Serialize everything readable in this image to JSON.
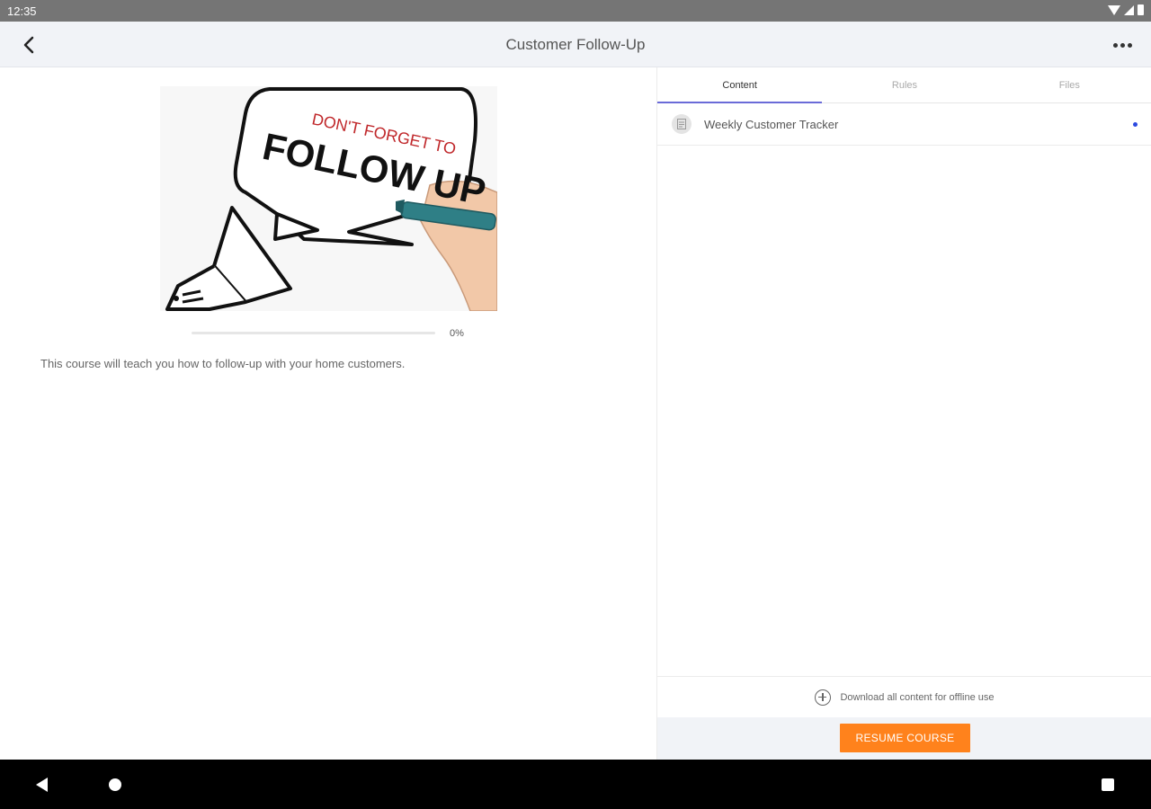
{
  "status_bar": {
    "time": "12:35",
    "icons": [
      "wifi-icon",
      "signal-icon",
      "battery-icon"
    ]
  },
  "app_bar": {
    "title": "Customer Follow-Up",
    "back_icon": "chevron-left-icon",
    "more_icon": "more-horizontal-icon"
  },
  "course": {
    "image_text_top": "DON'T FORGET TO",
    "image_text_main": "FOLLOW UP",
    "progress_label": "0%",
    "progress_fraction": 0,
    "description": "This course will teach you how to follow-up with your home customers."
  },
  "tabs": [
    {
      "label": "Content",
      "active": true
    },
    {
      "label": "Rules",
      "active": false
    },
    {
      "label": "Files",
      "active": false
    }
  ],
  "content_list": [
    {
      "label": "Weekly Customer Tracker",
      "icon": "document-icon",
      "unread": true
    }
  ],
  "download": {
    "label": "Download all content for offline use",
    "icon": "plus-circle-icon"
  },
  "resume_button": "RESUME COURSE",
  "colors": {
    "accent": "#ff821c",
    "tab_indicator": "#6a6bd8",
    "unread_dot": "#2b49e0"
  }
}
